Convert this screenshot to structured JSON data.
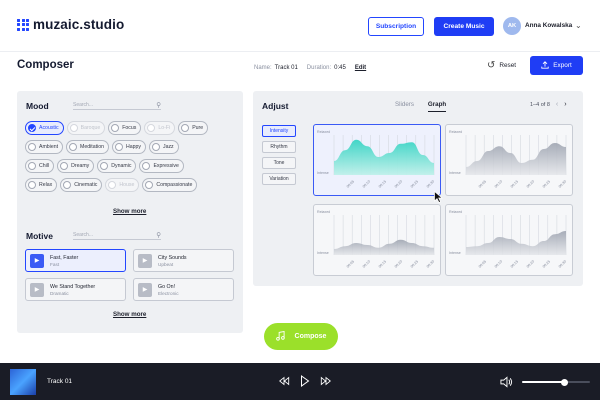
{
  "colors": {
    "accent": "#1f3df5",
    "compose": "#9be02a",
    "player_bg": "#1a1c26",
    "teal": "#39d4c4"
  },
  "header": {
    "logo_text": "muzaic.studio",
    "subscription_label": "Subscription",
    "create_music_label": "Create Music",
    "avatar_initials": "AK",
    "user_name": "Anna Kowalska"
  },
  "composer": {
    "title": "Composer",
    "name_label": "Name:",
    "name_value": "Track 01",
    "duration_label": "Duration:",
    "duration_value": "0:45",
    "edit_label": "Edit",
    "reset_label": "Reset",
    "export_label": "Export"
  },
  "mood": {
    "title": "Mood",
    "search_placeholder": "Search...",
    "rows": [
      [
        {
          "label": "Acoustic",
          "state": "selected"
        },
        {
          "label": "Baroque",
          "state": "disabled"
        },
        {
          "label": "Focus",
          "state": "normal"
        },
        {
          "label": "Lo-Fi",
          "state": "disabled"
        },
        {
          "label": "Pure",
          "state": "normal"
        }
      ],
      [
        {
          "label": "Ambient",
          "state": "normal"
        },
        {
          "label": "Meditation",
          "state": "normal"
        },
        {
          "label": "Happy",
          "state": "normal"
        },
        {
          "label": "Jazz",
          "state": "normal"
        }
      ],
      [
        {
          "label": "Chill",
          "state": "normal"
        },
        {
          "label": "Dreamy",
          "state": "normal"
        },
        {
          "label": "Dynamic",
          "state": "normal"
        },
        {
          "label": "Expressive",
          "state": "normal"
        }
      ],
      [
        {
          "label": "Relax",
          "state": "normal"
        },
        {
          "label": "Cinematic",
          "state": "normal"
        },
        {
          "label": "House",
          "state": "disabled"
        },
        {
          "label": "Compassionate",
          "state": "normal"
        }
      ]
    ],
    "show_more_label": "Show more"
  },
  "motive": {
    "title": "Motive",
    "search_placeholder": "Search...",
    "items": [
      {
        "name": "Fast, Faster",
        "genre": "Fast",
        "selected": true
      },
      {
        "name": "City Sounds",
        "genre": "Upbeat",
        "selected": false
      },
      {
        "name": "We Stand Together",
        "genre": "Dramatic",
        "selected": false
      },
      {
        "name": "Go On!",
        "genre": "Electronic",
        "selected": false
      }
    ],
    "show_more_label": "Show more"
  },
  "adjust": {
    "title": "Adjust",
    "view_tabs": [
      {
        "label": "Sliders",
        "active": false
      },
      {
        "label": "Graph",
        "active": true
      }
    ],
    "pager_text": "1–4 of 8",
    "side_tabs": [
      {
        "label": "Intensity",
        "active": true
      },
      {
        "label": "Rhythm",
        "active": false
      },
      {
        "label": "Tone",
        "active": false
      },
      {
        "label": "Variation",
        "active": false
      }
    ],
    "graph_top_label": "Relaxed",
    "graph_bottom_label": "Intense",
    "time_labels": [
      "00:05",
      "00:10",
      "00:15",
      "00:20",
      "00:25",
      "00:30"
    ],
    "graphs": [
      {
        "selected": true,
        "levels": [
          0.35,
          0.62,
          0.88,
          0.72,
          0.45,
          0.55,
          0.78,
          0.82,
          0.5,
          0.3
        ]
      },
      {
        "selected": false,
        "levels": [
          0.2,
          0.35,
          0.6,
          0.72,
          0.55,
          0.3,
          0.38,
          0.65,
          0.8,
          0.7
        ]
      },
      {
        "selected": false,
        "levels": [
          0.15,
          0.22,
          0.3,
          0.25,
          0.18,
          0.28,
          0.38,
          0.3,
          0.22,
          0.18
        ]
      },
      {
        "selected": false,
        "levels": [
          0.2,
          0.22,
          0.3,
          0.45,
          0.4,
          0.28,
          0.22,
          0.35,
          0.52,
          0.6
        ]
      }
    ]
  },
  "compose_label": "Compose",
  "player": {
    "track_name": "Track 01",
    "volume": 0.62
  },
  "icons": {
    "rewind": "rewind-icon",
    "play": "play-icon",
    "forward": "fast-forward-icon",
    "volume": "volume-icon",
    "export": "upload-icon",
    "reset": "reset-icon",
    "compose": "music-note-icon"
  }
}
